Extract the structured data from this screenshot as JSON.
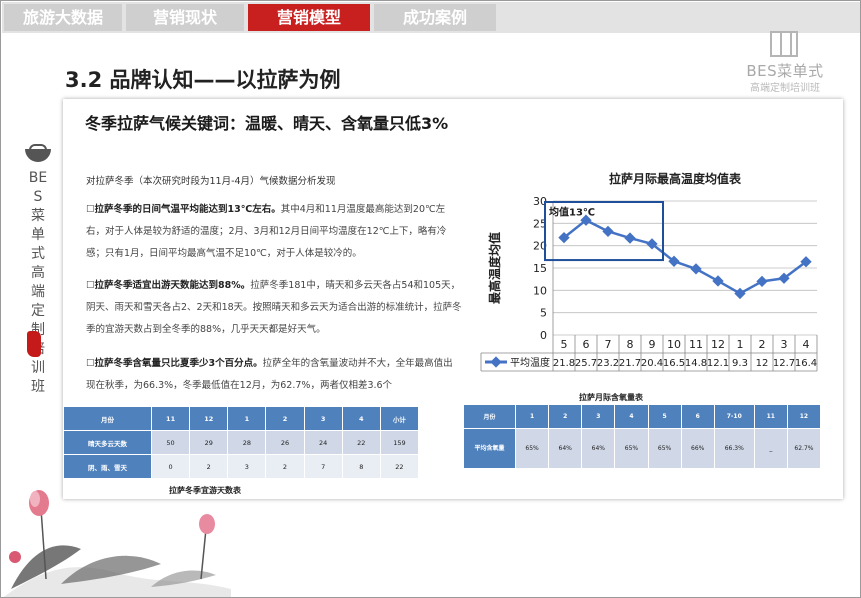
{
  "nav": {
    "tabs": [
      {
        "label": "旅游大数据",
        "active": false
      },
      {
        "label": "营销现状",
        "active": false
      },
      {
        "label": "营销模型",
        "active": true
      },
      {
        "label": "成功案例",
        "active": false
      }
    ]
  },
  "brand": {
    "name": "BES菜单式",
    "sub": "高端定制培训班"
  },
  "sidebar": {
    "vertical_text": "BES菜单式高端定制培训班"
  },
  "page": {
    "title": "3.2 品牌认知——以拉萨为例",
    "subtitle": "冬季拉萨气候关键词：温暖、晴天、含氧量只低3%"
  },
  "text": {
    "intro": "对拉萨冬季（本次研究时段为11月-4月）气候数据分析发现",
    "p1_bold": "拉萨冬季的日间气温平均能达到13℃左右。",
    "p1_rest": "其中4月和11月温度最高能达到20℃左右，对于人体是较为舒适的温度；2月、3月和12月日间平均温度在12℃上下，略有冷感；只有1月，日间平均最高气温不足10℃，对于人体是较冷的。",
    "p2_bold": "拉萨冬季适宜出游天数能达到88%。",
    "p2_rest": "拉萨冬季181中，晴天和多云天各占54和105天，阴天、雨天和雪天各占2、2天和18天。按照晴天和多云天为适合出游的标准统计，拉萨冬季的宜游天数占到全冬季的88%，几乎天天都是好天气。",
    "p3_bold": "拉萨冬季含氧量只比夏季少3个百分点。",
    "p3_rest": "拉萨全年的含氧量波动并不大，全年最高值出现在秋季，为66.3%，冬季最低值在12月，为62.7%，两者仅相差3.6个"
  },
  "table1": {
    "caption": "拉萨冬季宜游天数表",
    "header": [
      "月份",
      "11",
      "12",
      "1",
      "2",
      "3",
      "4",
      "小计"
    ],
    "rows": [
      [
        "晴天多云天数",
        "50",
        "29",
        "28",
        "26",
        "24",
        "22",
        "159"
      ],
      [
        "阴、雨、雪天",
        "0",
        "2",
        "3",
        "2",
        "7",
        "8",
        "22"
      ]
    ]
  },
  "table2": {
    "caption": "拉萨月际含氧量表",
    "header": [
      "月份",
      "1",
      "2",
      "3",
      "4",
      "5",
      "6",
      "7-10",
      "11",
      "12"
    ],
    "row_label": "平均含氧量",
    "values": [
      "65%",
      "64%",
      "64%",
      "65%",
      "65%",
      "66%",
      "66.3%",
      "_",
      "62.7%"
    ]
  },
  "chart_data": {
    "type": "line",
    "title": "拉萨月际最高温度均值表",
    "ylabel": "最高温度均值",
    "categories": [
      "5",
      "6",
      "7",
      "8",
      "9",
      "10",
      "11",
      "12",
      "1",
      "2",
      "3",
      "4"
    ],
    "series": [
      {
        "name": "平均温度",
        "values": [
          21.8,
          25.7,
          23.2,
          21.7,
          20.4,
          16.5,
          14.8,
          12.1,
          9.3,
          12,
          12.7,
          16.4
        ],
        "color": "#4472c4"
      }
    ],
    "value_labels": [
      "21.8",
      "25.7",
      "23.2",
      "21.7",
      "20.4",
      "16.5",
      "14.8",
      "12.1",
      "9.3",
      "12",
      "12.7",
      "16.4"
    ],
    "ylim": [
      0,
      30
    ],
    "yticks": [
      0,
      5,
      10,
      15,
      20,
      25,
      30
    ],
    "annotation": "均值13℃",
    "highlight_box_color": "#1f4e9a",
    "grid": true
  }
}
